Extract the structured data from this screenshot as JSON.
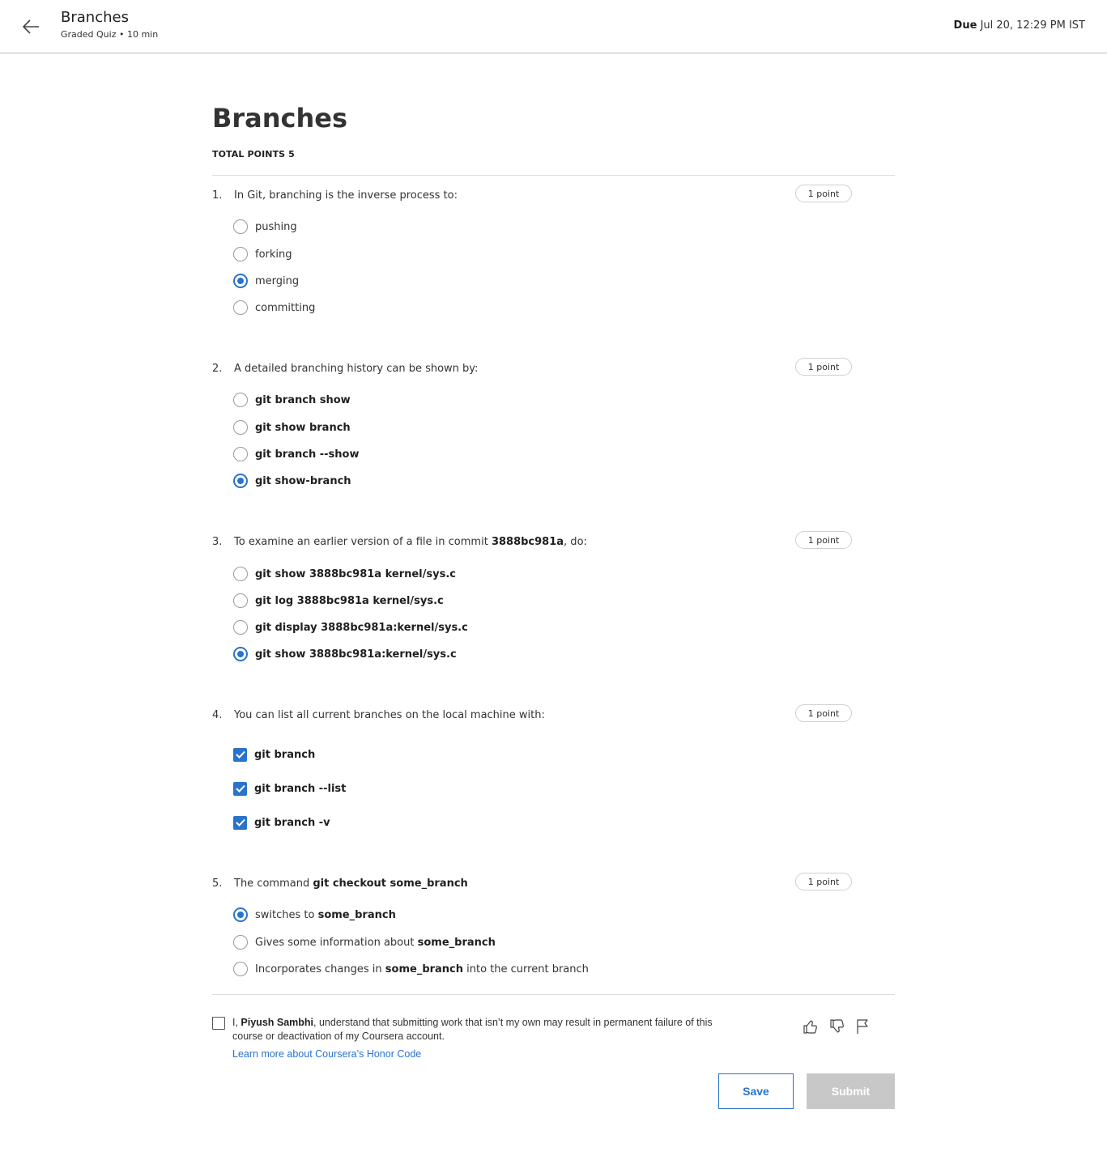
{
  "header": {
    "title": "Branches",
    "subtitle": "Graded Quiz • 10 min",
    "due_label": "Due",
    "due_value": "Jul 20, 12:29 PM IST"
  },
  "quiz": {
    "title": "Branches",
    "total_points": "TOTAL POINTS 5"
  },
  "questions": [
    {
      "number": "1.",
      "text": "In Git, branching is the inverse process to:",
      "points": "1 point",
      "type": "radio",
      "options": [
        {
          "label": "pushing",
          "selected": false
        },
        {
          "label": "forking",
          "selected": false
        },
        {
          "label": "merging",
          "selected": true
        },
        {
          "label": "committing",
          "selected": false
        }
      ]
    },
    {
      "number": "2.",
      "text": "A detailed branching history can be shown by:",
      "points": "1 point",
      "type": "radio",
      "options": [
        {
          "label": "git branch show",
          "selected": false
        },
        {
          "label": "git show branch",
          "selected": false
        },
        {
          "label": "git branch --show",
          "selected": false
        },
        {
          "label": "git show-branch",
          "selected": true
        }
      ]
    },
    {
      "number": "3.",
      "text_before": "To examine an earlier version of a file in commit ",
      "text_bold": "3888bc981a",
      "text_after": ", do:",
      "points": "1 point",
      "type": "radio",
      "options": [
        {
          "label": "git show 3888bc981a kernel/sys.c",
          "selected": false
        },
        {
          "label": "git log 3888bc981a kernel/sys.c",
          "selected": false
        },
        {
          "label": "git display 3888bc981a:kernel/sys.c",
          "selected": false
        },
        {
          "label": "git show 3888bc981a:kernel/sys.c",
          "selected": true
        }
      ]
    },
    {
      "number": "4.",
      "text": "You can list all current branches on the local machine with:",
      "points": "1 point",
      "type": "checkbox",
      "options": [
        {
          "label": "git branch",
          "checked": true
        },
        {
          "label": "git branch --list",
          "checked": true
        },
        {
          "label": "git branch -v",
          "checked": true
        }
      ]
    },
    {
      "number": "5.",
      "text_before": "The command ",
      "text_bold": "git checkout some_branch",
      "points": "1 point",
      "type": "radio",
      "options": [
        {
          "before": "switches to ",
          "bold": "some_branch",
          "after": "",
          "selected": true
        },
        {
          "before": "Gives some information about ",
          "bold": "some_branch",
          "after": "",
          "selected": false
        },
        {
          "before": "Incorporates changes in ",
          "bold": "some_branch",
          "after": " into the current branch",
          "selected": false
        }
      ]
    }
  ],
  "honor": {
    "prefix": "I, ",
    "name": "Piyush Sambhi",
    "suffix": ", understand that submitting work that isn’t my own may result in permanent failure of this course or deactivation of my Coursera account.",
    "link": "Learn more about Coursera’s Honor Code",
    "checked": false
  },
  "feedback_icons": [
    "thumbs-up-icon",
    "thumbs-down-icon",
    "flag-icon"
  ],
  "actions": {
    "save": "Save",
    "submit": "Submit",
    "submit_enabled": false
  },
  "colors": {
    "accent": "#2a73cc",
    "disabled": "#c8c8c8",
    "divider": "#dcdcdc"
  }
}
